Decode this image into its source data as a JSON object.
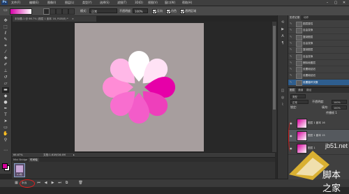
{
  "menubar": {
    "logo": "Ps",
    "items": [
      "文件(F)",
      "编辑(E)",
      "图像(I)",
      "图层(L)",
      "类型(Y)",
      "选择(S)",
      "滤镜(T)",
      "3D(D)",
      "视图(V)",
      "窗口(W)",
      "帮助(H)"
    ],
    "window_buttons": [
      "–",
      "▢",
      "✕"
    ]
  },
  "options": {
    "mode_label": "模式:",
    "mode_value": "正常",
    "opacity_label": "不透明度:",
    "opacity_value": "100%",
    "reverse_label": "反向",
    "dither_label": "仿色",
    "transparency_label": "透明区域"
  },
  "document": {
    "tab_label": "未标题-1 @ 66.7% (图层 1 副本 16, RGB/8) *",
    "tab_close": "×"
  },
  "status": {
    "zoom": "66.67%",
    "doc_info": "文档:1.61M/16.4M",
    "arrow": "▸"
  },
  "timeline": {
    "tabs": [
      "Mini Bridge",
      "时间轴"
    ],
    "frame_time": "0.2秒"
  },
  "bottombar": {
    "loop_label": "永远",
    "icons": [
      "⏮",
      "◀",
      "▶",
      "⏭",
      "⧉",
      "🗑"
    ]
  },
  "history": {
    "tabs": [
      "历史记录",
      "动作"
    ],
    "rows": [
      {
        "label": "图层属性",
        "active": false
      },
      {
        "label": "自由变换",
        "active": false
      },
      {
        "label": "复制图层",
        "active": false
      },
      {
        "label": "自由变换",
        "active": false
      },
      {
        "label": "复制图层",
        "active": false
      },
      {
        "label": "自由变换",
        "active": false
      },
      {
        "label": "删除帧图层",
        "active": false
      },
      {
        "label": "设置帧延迟",
        "active": false
      },
      {
        "label": "设置帧延迟",
        "active": false
      },
      {
        "label": "设置循环次数",
        "active": true
      }
    ]
  },
  "layers": {
    "tabs": [
      "图层",
      "通道",
      "路径"
    ],
    "kind_label": "类型",
    "blend_value": "正常",
    "opacity_label": "不透明度:",
    "opacity_value": "100%",
    "lock_label": "锁定:",
    "fill_label": "填充:",
    "fill_value": "100%",
    "propagate_label": "传播帧 1",
    "rows": [
      {
        "name": "图层 1 副本 16",
        "active": false
      },
      {
        "name": "图层 1 副本 15",
        "active": true
      },
      {
        "name": "图层 1",
        "active": false
      }
    ]
  },
  "watermark": {
    "site": "jb51.net",
    "brand": "脚本之家"
  },
  "colors": {
    "foreground": "#d7009c",
    "background": "#ffffff",
    "canvas": "#a79e9e",
    "selection": "#2e5e8f"
  },
  "artwork": {
    "petals": [
      {
        "angle": 0,
        "color": "#ff8cd6"
      },
      {
        "angle": 45,
        "color": "#ffb8e7"
      },
      {
        "angle": 90,
        "color": "#ffffff"
      },
      {
        "angle": 135,
        "color": "#ffe2f5"
      },
      {
        "angle": 180,
        "color": "#e600a8"
      },
      {
        "angle": 225,
        "color": "#ee3fbb"
      },
      {
        "angle": 270,
        "color": "#f35cc9"
      },
      {
        "angle": 315,
        "color": "#f86ecf"
      }
    ]
  }
}
